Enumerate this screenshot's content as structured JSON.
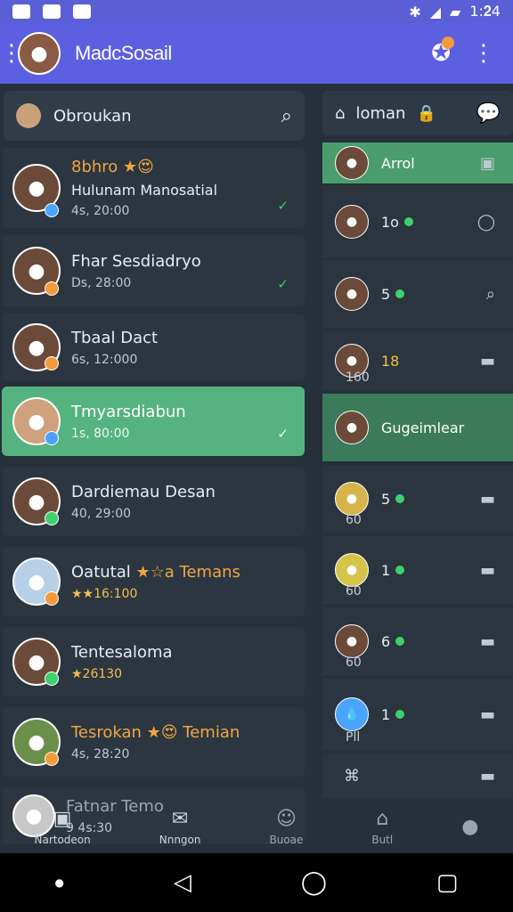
{
  "status_bar": {
    "time": "1:𝟐4"
  },
  "app_bar": {
    "title": "MadcSosail"
  },
  "left": {
    "search_label": "Obroukan",
    "chats": [
      {
        "name": "8bhro ★😍",
        "subtitle": "Hulunam Manosatial",
        "meta": "4s, 20:00"
      },
      {
        "name": "Fhar Sesdiadryo",
        "subtitle": "",
        "meta": "Ds, 28:00"
      },
      {
        "name": "Tbaal Dact",
        "subtitle": "",
        "meta": "6s, 12:000"
      },
      {
        "name": "Tmyarsdiabun",
        "subtitle": "",
        "meta": "1s, 80:00"
      },
      {
        "name": "Dardiemau Desan",
        "subtitle": "",
        "meta": "40, 29:00"
      },
      {
        "name": "Oatutal",
        "subtitle": "★☆a Temans",
        "meta": "★★16:100"
      },
      {
        "name": "Tentesaloma",
        "subtitle": "",
        "meta": "★26130"
      },
      {
        "name": "Tesrokan ★😍 Temian",
        "subtitle": "",
        "meta": "4s, 28:20"
      },
      {
        "name": "Fatnar Temo",
        "subtitle": "",
        "meta": "9 4s:30"
      }
    ]
  },
  "right": {
    "top_label": "loman",
    "rows": [
      {
        "label": "Arrol",
        "type": "header"
      },
      {
        "label": "1o",
        "type": "green-dot"
      },
      {
        "label": "5",
        "type": "green-dot"
      },
      {
        "label": "18",
        "type": "meta",
        "small": "160"
      },
      {
        "label": "Gugeimlear",
        "type": "green"
      },
      {
        "label": "5",
        "type": "green-dot",
        "small": "60"
      },
      {
        "label": "1",
        "type": "green-dot",
        "small": "60"
      },
      {
        "label": "6",
        "type": "green-dot",
        "small": "60"
      },
      {
        "label": "1",
        "type": "green-dot",
        "small": "Pll"
      }
    ]
  },
  "bottom_nav": [
    {
      "label": "Nartodeon"
    },
    {
      "label": "Nnngon"
    },
    {
      "label": "Buoae"
    },
    {
      "label": "Butl"
    },
    {
      "label": ""
    }
  ]
}
